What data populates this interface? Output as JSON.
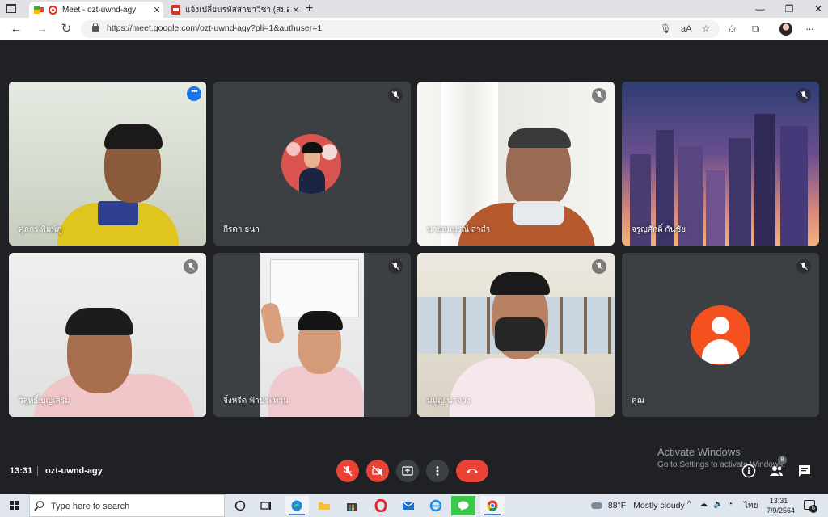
{
  "browser": {
    "tabs": [
      {
        "title": "Meet - ozt-uwnd-agy",
        "active": true
      },
      {
        "title": "แจ้งเปลี่ยนรหัสสาขาวิชา (สมอ).pdf",
        "active": false
      }
    ],
    "close_label": "✕",
    "new_tab_label": "+",
    "window_controls": {
      "minimize": "—",
      "restore": "❐",
      "close": "✕"
    },
    "url": "https://meet.google.com/ozt-uwnd-agy?pli=1&authuser=1",
    "reader_label": "aA",
    "menu_label": "···"
  },
  "participants": [
    {
      "name": "ศุภกร พิมพ์ภู",
      "muted": false,
      "highlighted": true
    },
    {
      "name": "กีรดา ธนา",
      "muted": true,
      "highlighted": false
    },
    {
      "name": "นายสมบูรณ์ สาสำ",
      "muted": true,
      "highlighted": false
    },
    {
      "name": "จรูญศักดิ์ กันชัย",
      "muted": true,
      "highlighted": false
    },
    {
      "name": "วิสุทธิ์ บุญเสริม",
      "muted": true,
      "highlighted": false
    },
    {
      "name": "จิ้งหรีด ฟ้าประทาน",
      "muted": true,
      "highlighted": false
    },
    {
      "name": "มนูญ นาจวง",
      "muted": true,
      "highlighted": false
    },
    {
      "name": "คุณ",
      "muted": true,
      "highlighted": false
    }
  ],
  "tile_menu_label": "•••",
  "meeting": {
    "time": "13:31",
    "code": "ozt-uwnd-agy",
    "participant_count": "8"
  },
  "watermark": {
    "line1": "Activate Windows",
    "line2": "Go to Settings to activate Windows."
  },
  "taskbar": {
    "search_placeholder": "Type here to search",
    "weather_temp": "88°F",
    "weather_text": "Mostly cloudy",
    "input_lang": "ไทย",
    "clock_time": "13:31",
    "clock_date": "7/9/2564",
    "notification_count": "6"
  },
  "colors": {
    "meet_background": "#202124",
    "tile_background": "#3c4043",
    "accent_red": "#ea4335",
    "highlight_blue": "#8ab4f8"
  }
}
